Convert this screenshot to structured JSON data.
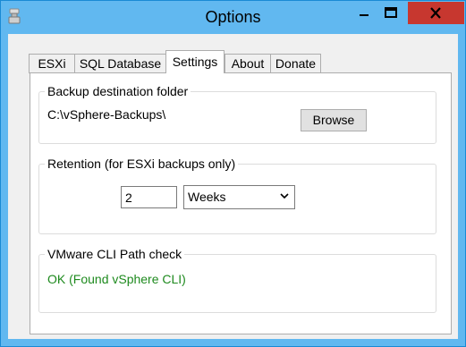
{
  "window": {
    "title": "Options",
    "app_icon": "app-icon",
    "minimize_icon": "minimize-icon",
    "maximize_icon": "maximize-icon",
    "close_icon": "close-icon",
    "close_color": "#c7372f",
    "titlebar_color": "#61b8f0"
  },
  "tabs": [
    {
      "label": "ESXi",
      "active": false
    },
    {
      "label": "SQL Database",
      "active": false
    },
    {
      "label": "Settings",
      "active": true
    },
    {
      "label": "About",
      "active": false
    },
    {
      "label": "Donate",
      "active": false
    }
  ],
  "settings": {
    "backup": {
      "legend": "Backup destination folder",
      "path": "C:\\vSphere-Backups\\",
      "browse_label": "Browse"
    },
    "retention": {
      "legend": "Retention (for ESXi backups only)",
      "value": "2",
      "unit_selected": "Weeks",
      "unit_icon": "chevron-down-icon"
    },
    "cli": {
      "legend": "VMware CLI Path check",
      "status": "OK (Found vSphere CLI)",
      "status_color": "#1e8a1e"
    }
  }
}
